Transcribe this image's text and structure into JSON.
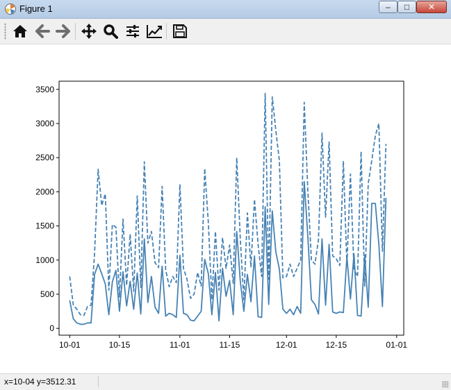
{
  "window": {
    "title": "Figure 1",
    "minimize_glyph": "‒",
    "maximize_glyph": "□",
    "close_glyph": "✕"
  },
  "toolbar": {
    "buttons": [
      {
        "name": "home",
        "icon": "home-icon"
      },
      {
        "name": "back",
        "icon": "arrow-left-icon"
      },
      {
        "name": "forward",
        "icon": "arrow-right-icon"
      },
      {
        "name": "pan",
        "icon": "move-icon"
      },
      {
        "name": "zoom",
        "icon": "magnifier-icon"
      },
      {
        "name": "configure-subplots",
        "icon": "sliders-icon"
      },
      {
        "name": "edit-axis",
        "icon": "line-chart-icon"
      },
      {
        "name": "save",
        "icon": "floppy-disk-icon"
      }
    ]
  },
  "status": {
    "coords": "x=10-04 y=3512.31"
  },
  "colors": {
    "line": "#4682b4",
    "axes": "#000000"
  },
  "chart_data": {
    "type": "line",
    "x_ticks": [
      "10-01",
      "10-15",
      "11-01",
      "11-15",
      "12-01",
      "12-15",
      "01-01"
    ],
    "y_ticks": [
      "0",
      "500",
      "1000",
      "1500",
      "2000",
      "2500",
      "3000",
      "3500"
    ],
    "ylim": [
      -100,
      3620
    ],
    "xlim_days": [
      -3.0,
      94.0
    ],
    "x_days": [
      0,
      1,
      2,
      3,
      4,
      5,
      6,
      7,
      8,
      9,
      10,
      11,
      12,
      13,
      14,
      15,
      16,
      17,
      18,
      19,
      20,
      21,
      22,
      23,
      24,
      25,
      26,
      27,
      28,
      29,
      30,
      31,
      32,
      33,
      34,
      35,
      36,
      37,
      38,
      39,
      40,
      41,
      42,
      43,
      44,
      45,
      46,
      47,
      48,
      49,
      50,
      51,
      52,
      53,
      54,
      55,
      56,
      57,
      58,
      59,
      60,
      61,
      62,
      63,
      64,
      65,
      66,
      67,
      68,
      69,
      70,
      71,
      72,
      73,
      74,
      75,
      76,
      77,
      78,
      79,
      80,
      81,
      82,
      83,
      84,
      85,
      86,
      87,
      88,
      89,
      90,
      91
    ],
    "series": [
      {
        "style": "dashed",
        "values": [
          760,
          340,
          280,
          200,
          190,
          320,
          340,
          1100,
          2330,
          1800,
          1970,
          560,
          1520,
          1480,
          460,
          1600,
          630,
          1380,
          540,
          1940,
          600,
          2440,
          1250,
          1420,
          960,
          890,
          2080,
          860,
          610,
          760,
          670,
          2110,
          880,
          720,
          440,
          500,
          820,
          620,
          2340,
          1550,
          420,
          1420,
          560,
          1330,
          880,
          1220,
          660,
          2500,
          1310,
          420,
          1690,
          900,
          1890,
          1230,
          760,
          3440,
          720,
          3390,
          2900,
          2460,
          740,
          760,
          940,
          760,
          880,
          1000,
          3310,
          2040,
          1000,
          940,
          1300,
          2860,
          1630,
          2730,
          1060,
          1020,
          920,
          2450,
          920,
          2260,
          860,
          760,
          2590,
          620,
          2120,
          2460,
          2820,
          3000,
          1130,
          2700
        ]
      },
      {
        "style": "solid",
        "values": [
          410,
          140,
          80,
          60,
          60,
          80,
          80,
          790,
          940,
          800,
          650,
          200,
          680,
          850,
          250,
          830,
          330,
          690,
          280,
          810,
          210,
          1310,
          380,
          760,
          310,
          220,
          910,
          180,
          220,
          200,
          160,
          1070,
          220,
          200,
          120,
          110,
          180,
          250,
          1010,
          800,
          200,
          820,
          110,
          880,
          470,
          700,
          200,
          1420,
          690,
          250,
          790,
          390,
          1060,
          170,
          160,
          1780,
          350,
          1720,
          1120,
          870,
          280,
          220,
          280,
          200,
          320,
          220,
          2150,
          1360,
          420,
          350,
          210,
          1310,
          340,
          1230,
          240,
          220,
          240,
          230,
          1050,
          430,
          1090,
          190,
          180,
          1070,
          310,
          1830,
          1830,
          1230,
          320,
          1910
        ]
      }
    ]
  }
}
